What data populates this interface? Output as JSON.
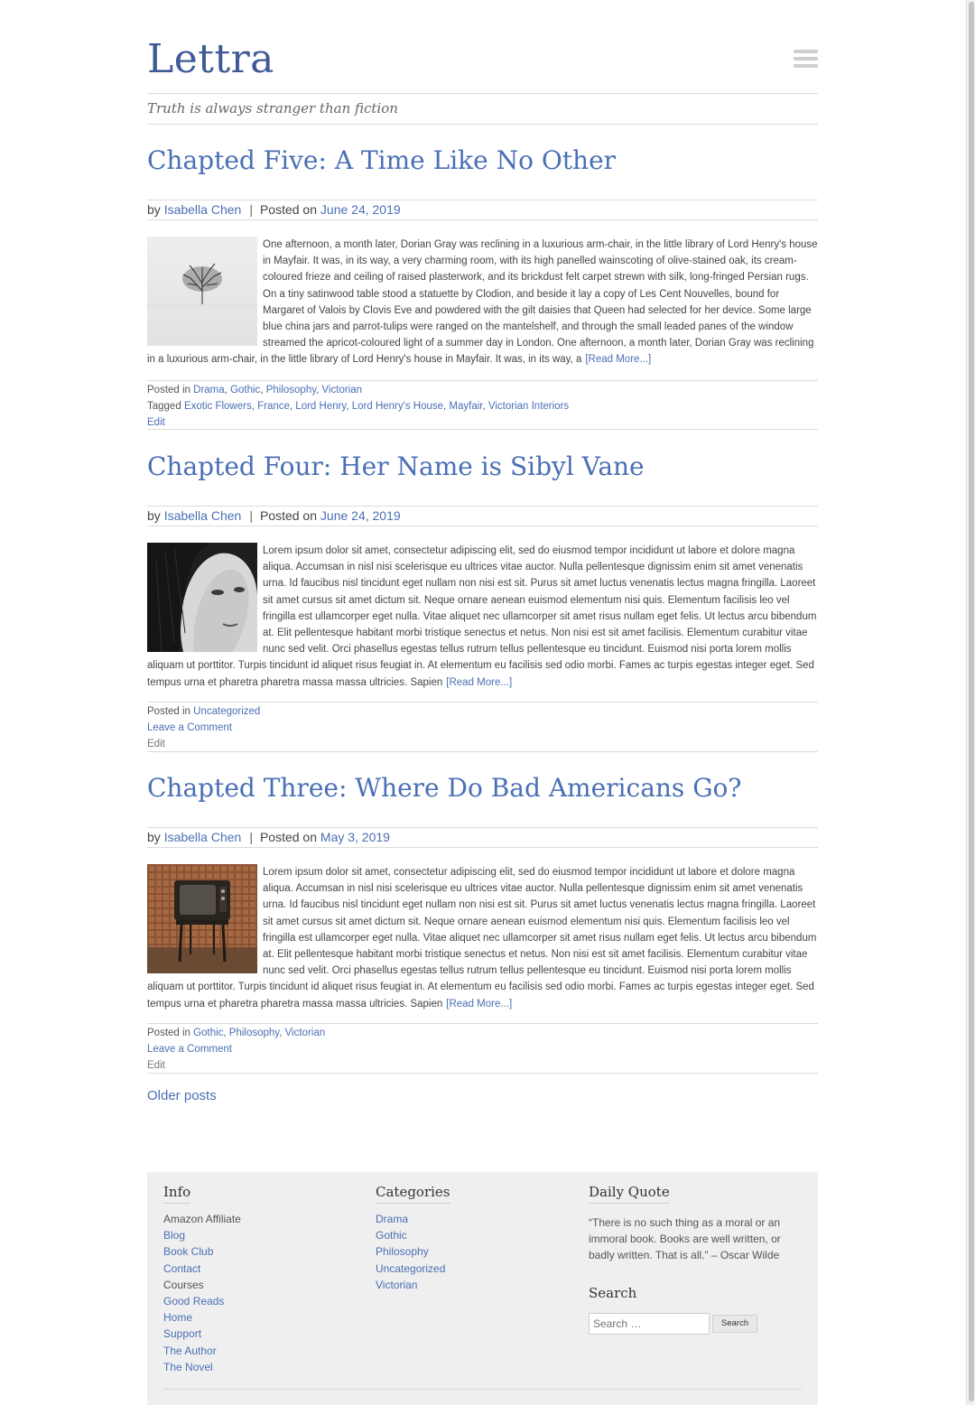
{
  "site": {
    "title": "Lettra",
    "tagline": "Truth is always stranger than fiction"
  },
  "posts": [
    {
      "title": "Chapted Five: A Time Like No Other",
      "by_label": "by",
      "author": "Isabella Chen",
      "sep": "|",
      "posted_on_label": "Posted on",
      "date": "June 24, 2019",
      "thumbnail": "snowy-tree-image",
      "excerpt": "One afternoon, a month later, Dorian Gray was reclining in a luxurious arm-chair, in the little library of Lord Henry's house in Mayfair. It was, in its way, a very charming room, with its high panelled wainscoting of olive-stained oak, its cream-coloured frieze and ceiling of raised plasterwork, and its brickdust felt carpet strewn with silk, long-fringed Persian rugs. On a tiny satinwood table stood a statuette by Clodion, and beside it lay a copy of Les Cent Nouvelles, bound for Margaret of Valois by Clovis Eve and powdered with the gilt daisies that Queen had selected for her device. Some large blue china jars and parrot-tulips were ranged on the mantelshelf, and through the small leaded panes of the window streamed the apricot-coloured light of a summer day in London. One afternoon, a month later, Dorian Gray was reclining in a luxurious arm-chair, in the little library of Lord Henry's house in Mayfair. It was, in its way, a",
      "read_more": "[Read More...]",
      "posted_in_label": "Posted in",
      "categories": [
        "Drama",
        "Gothic",
        "Philosophy",
        "Victorian"
      ],
      "tagged_label": "Tagged",
      "tags": [
        "Exotic Flowers",
        "France",
        "Lord Henry",
        "Lord Henry's House",
        "Mayfair",
        "Victorian Interiors"
      ],
      "comment_link": "",
      "edit": "Edit"
    },
    {
      "title": "Chapted Four: Her Name is Sibyl Vane",
      "by_label": "by",
      "author": "Isabella Chen",
      "sep": "|",
      "posted_on_label": "Posted on",
      "date": "June 24, 2019",
      "thumbnail": "woman-portrait-image",
      "excerpt": "Lorem ipsum dolor sit amet, consectetur adipiscing elit, sed do eiusmod tempor incididunt ut labore et dolore magna aliqua. Accumsan in nisl nisi scelerisque eu ultrices vitae auctor. Nulla pellentesque dignissim enim sit amet venenatis urna. Id faucibus nisl tincidunt eget nullam non nisi est sit. Purus sit amet luctus venenatis lectus magna fringilla. Laoreet sit amet cursus sit amet dictum sit. Neque ornare aenean euismod elementum nisi quis. Elementum facilisis leo vel fringilla est ullamcorper eget nulla. Vitae aliquet nec ullamcorper sit amet risus nullam eget felis. Ut lectus arcu bibendum at. Elit pellentesque habitant morbi tristique senectus et netus. Non nisi est sit amet facilisis. Elementum curabitur vitae nunc sed velit. Orci phasellus egestas tellus rutrum tellus pellentesque eu tincidunt. Euismod nisi porta lorem mollis aliquam ut porttitor. Turpis tincidunt id aliquet risus feugiat in. At elementum eu facilisis sed odio morbi. Fames ac turpis egestas integer eget. Sed tempus urna et pharetra pharetra massa massa ultricies. Sapien",
      "read_more": "[Read More...]",
      "posted_in_label": "Posted in",
      "categories": [
        "Uncategorized"
      ],
      "tagged_label": "",
      "tags": [],
      "comment_link": "Leave a Comment",
      "edit": "Edit"
    },
    {
      "title": "Chapted Three: Where Do Bad Americans Go?",
      "by_label": "by",
      "author": "Isabella Chen",
      "sep": "|",
      "posted_on_label": "Posted on",
      "date": "May 3, 2019",
      "thumbnail": "retro-tv-image",
      "excerpt": "Lorem ipsum dolor sit amet, consectetur adipiscing elit, sed do eiusmod tempor incididunt ut labore et dolore magna aliqua. Accumsan in nisl nisi scelerisque eu ultrices vitae auctor. Nulla pellentesque dignissim enim sit amet venenatis urna. Id faucibus nisl tincidunt eget nullam non nisi est sit. Purus sit amet luctus venenatis lectus magna fringilla. Laoreet sit amet cursus sit amet dictum sit. Neque ornare aenean euismod elementum nisi quis. Elementum facilisis leo vel fringilla est ullamcorper eget nulla. Vitae aliquet nec ullamcorper sit amet risus nullam eget felis. Ut lectus arcu bibendum at. Elit pellentesque habitant morbi tristique senectus et netus. Non nisi est sit amet facilisis. Elementum curabitur vitae nunc sed velit. Orci phasellus egestas tellus rutrum tellus pellentesque eu tincidunt. Euismod nisi porta lorem mollis aliquam ut porttitor. Turpis tincidunt id aliquet risus feugiat in. At elementum eu facilisis sed odio morbi. Fames ac turpis egestas integer eget. Sed tempus urna et pharetra pharetra massa massa ultricies. Sapien",
      "read_more": "[Read More...]",
      "posted_in_label": "Posted in",
      "categories": [
        "Gothic",
        "Philosophy",
        "Victorian"
      ],
      "tagged_label": "",
      "tags": [],
      "comment_link": "Leave a Comment",
      "edit": "Edit"
    }
  ],
  "pagination": {
    "older": "Older posts"
  },
  "footer": {
    "info": {
      "heading": "Info",
      "items": [
        {
          "label": "Amazon Affiliate",
          "link": false
        },
        {
          "label": "Blog",
          "link": true
        },
        {
          "label": "Book Club",
          "link": true
        },
        {
          "label": "Contact",
          "link": true
        },
        {
          "label": "Courses",
          "link": false
        },
        {
          "label": "Good Reads",
          "link": true
        },
        {
          "label": "Home",
          "link": true
        },
        {
          "label": "Support",
          "link": true
        },
        {
          "label": "The Author",
          "link": true
        },
        {
          "label": "The Novel",
          "link": true
        }
      ]
    },
    "categories": {
      "heading": "Categories",
      "items": [
        "Drama",
        "Gothic",
        "Philosophy",
        "Uncategorized",
        "Victorian"
      ]
    },
    "quote": {
      "heading": "Daily Quote",
      "text": "“There is no such thing as a moral or an immoral book. Books are well written, or badly written. That is all.” – Oscar Wilde"
    },
    "search": {
      "heading": "Search",
      "placeholder": "Search …",
      "button": "Search"
    }
  },
  "colors": {
    "link": "#4a6fb5",
    "title": "#3f5a96",
    "footer_bg": "#efefef"
  }
}
